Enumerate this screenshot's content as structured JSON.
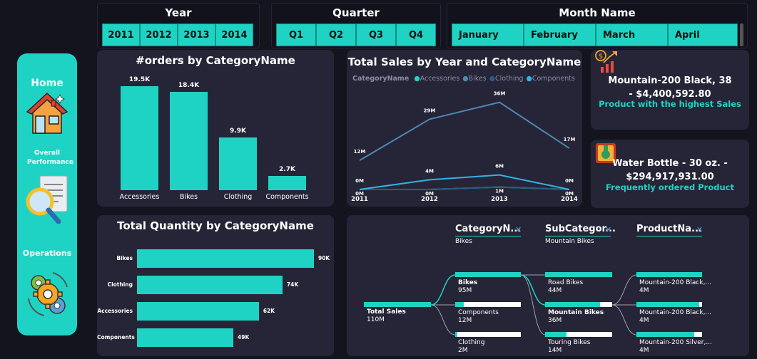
{
  "slicers": {
    "year": {
      "title": "Year",
      "items": [
        "2011",
        "2012",
        "2013",
        "2014"
      ]
    },
    "quarter": {
      "title": "Quarter",
      "items": [
        "Q1",
        "Q2",
        "Q3",
        "Q4"
      ]
    },
    "month": {
      "title": "Month Name",
      "items": [
        "January",
        "February",
        "March",
        "April"
      ]
    }
  },
  "sidebar": {
    "home": "Home",
    "overall": "Overall Performance",
    "operations": "Operations"
  },
  "orders_chart": {
    "title": "#orders by CategoryName",
    "chart_data": {
      "type": "bar",
      "categories": [
        "Accessories",
        "Bikes",
        "Clothing",
        "Components"
      ],
      "values": [
        19.5,
        18.4,
        9.9,
        2.7
      ],
      "labels": [
        "19.5K",
        "18.4K",
        "9.9K",
        "2.7K"
      ],
      "ylim": [
        0,
        20
      ]
    }
  },
  "sales_chart": {
    "title": "Total Sales by Year and CategoryName",
    "legend_title": "CategoryName",
    "chart_data": {
      "type": "line",
      "x": [
        "2011",
        "2012",
        "2013",
        "2014"
      ],
      "series": [
        {
          "name": "Accessories",
          "values": [
            0,
            0,
            1,
            0
          ],
          "labels": [
            "0M",
            "0M",
            "1M",
            "0M"
          ],
          "color": "#20d5c7"
        },
        {
          "name": "Bikes",
          "values": [
            12,
            29,
            36,
            17
          ],
          "labels": [
            "12M",
            "29M",
            "36M",
            "17M"
          ],
          "color": "#4f86b5"
        },
        {
          "name": "Clothing",
          "values": [
            0,
            0,
            1,
            0
          ],
          "labels": [
            "",
            "",
            "",
            ""
          ],
          "color": "#2a5a86"
        },
        {
          "name": "Components",
          "values": [
            0,
            4,
            6,
            0
          ],
          "labels": [
            "0M",
            "4M",
            "6M",
            "0M"
          ],
          "color": "#2fb4e6"
        }
      ],
      "ylim": [
        0,
        40
      ]
    }
  },
  "kpi1": {
    "main": "Mountain-200 Black, 38 - $4,400,592.80",
    "sub": "Product with the highest Sales"
  },
  "kpi2": {
    "main": "Water Bottle - 30 oz. - $294,917,931.00",
    "sub": "Frequently ordered Product"
  },
  "qty_chart": {
    "title": "Total Quantity by CategoryName",
    "chart_data": {
      "type": "bar",
      "orientation": "horizontal",
      "categories": [
        "Bikes",
        "Clothing",
        "Accessories",
        "Components"
      ],
      "values": [
        90,
        74,
        62,
        49
      ],
      "labels": [
        "90K",
        "74K",
        "62K",
        "49K"
      ],
      "xlim": [
        0,
        90
      ]
    }
  },
  "decomp": {
    "headers": [
      {
        "title": "CategoryN...",
        "sub": "Bikes"
      },
      {
        "title": "SubCategor...",
        "sub": "Mountain Bikes"
      },
      {
        "title": "ProductNa...",
        "sub": ""
      }
    ],
    "root": {
      "name": "Total Sales",
      "value": "110M"
    },
    "level1": [
      {
        "name": "Bikes",
        "value": "95M",
        "fill": 1.0
      },
      {
        "name": "Components",
        "value": "12M",
        "fill": 0.13
      },
      {
        "name": "Clothing",
        "value": "2M",
        "fill": 0.03
      }
    ],
    "level2": [
      {
        "name": "Road Bikes",
        "value": "44M",
        "fill": 1.0
      },
      {
        "name": "Mountain Bikes",
        "value": "36M",
        "fill": 0.82
      },
      {
        "name": "Touring Bikes",
        "value": "14M",
        "fill": 0.32
      }
    ],
    "level3": [
      {
        "name": "Mountain-200 Black,...",
        "value": "4M",
        "fill": 1.0
      },
      {
        "name": "Mountain-200 Black,...",
        "value": "4M",
        "fill": 0.96
      },
      {
        "name": "Mountain-200 Silver,...",
        "value": "4M",
        "fill": 0.88
      }
    ]
  }
}
